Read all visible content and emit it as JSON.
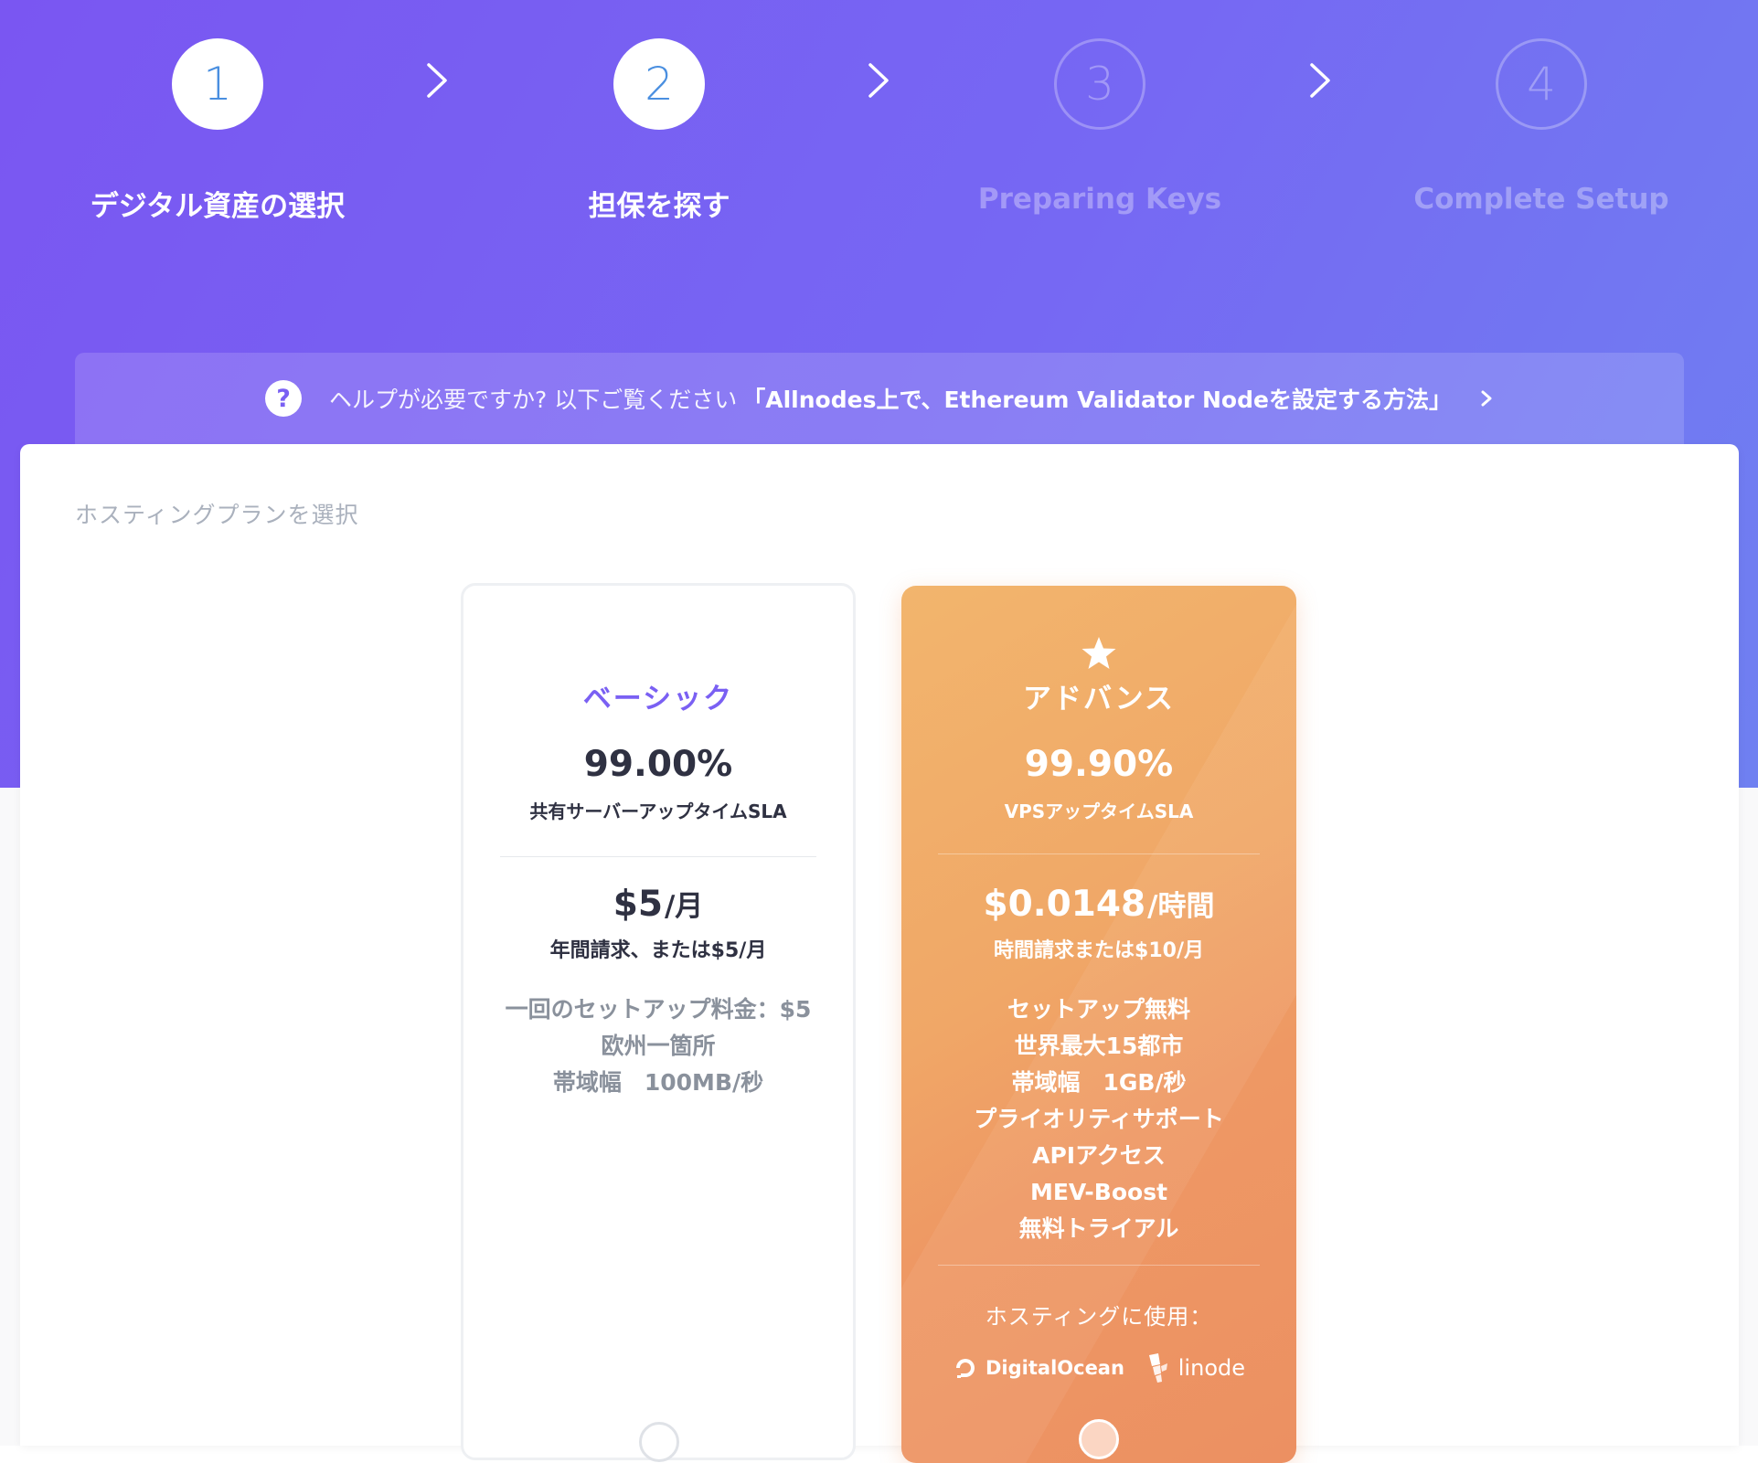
{
  "stepper": {
    "steps": [
      {
        "number": "1",
        "label": "デジタル資産の選択",
        "state": "active"
      },
      {
        "number": "2",
        "label": "担保を探す",
        "state": "active"
      },
      {
        "number": "3",
        "label": "Preparing Keys",
        "state": "inactive"
      },
      {
        "number": "4",
        "label": "Complete Setup",
        "state": "inactive"
      }
    ]
  },
  "help": {
    "icon": "question-icon",
    "text": "ヘルプが必要ですか? 以下ご覧ください",
    "link": "「Allnodes上で、Ethereum Validator Nodeを設定する方法」"
  },
  "section_title": "ホスティングプランを選択",
  "plans": {
    "basic": {
      "name": "ベーシック",
      "uptime": "99.00%",
      "uptime_label": "共有サーバーアップタイムSLA",
      "price": "$5",
      "price_unit": "/月",
      "billing": "年間請求、または$5/月",
      "features": [
        "一回のセットアップ料金：$5",
        "欧州一箇所",
        "帯域幅　100MB/秒"
      ],
      "selected": false
    },
    "advanced": {
      "icon": "star-icon",
      "name": "アドバンス",
      "uptime": "99.90%",
      "uptime_label": "VPSアップタイムSLA",
      "price": "$0.0148",
      "price_unit": "/時間",
      "billing": "時間請求または$10/月",
      "features": [
        "セットアップ無料",
        "世界最大15都市",
        "帯域幅　1GB/秒",
        "プライオリティサポート",
        "APIアクセス",
        "MEV-Boost",
        "無料トライアル"
      ],
      "hosted_label": "ホスティングに使用：",
      "providers": [
        "DigitalOcean",
        "linode"
      ],
      "selected": true
    }
  },
  "colors": {
    "hero_start": "#7a56f2",
    "hero_end": "#6f80f1",
    "accent_blue": "#4a8fe0",
    "accent_purple": "#7a60f3",
    "advanced_orange": "#f0a767"
  }
}
